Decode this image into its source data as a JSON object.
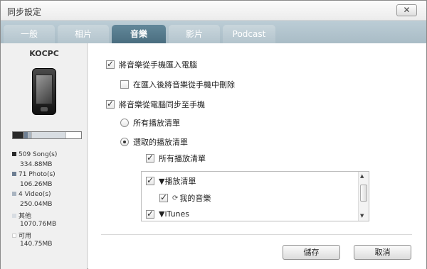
{
  "window": {
    "title": "同步設定",
    "close_label": "✕"
  },
  "tabs": [
    {
      "label": "一般",
      "active": false
    },
    {
      "label": "相片",
      "active": false
    },
    {
      "label": "音樂",
      "active": true
    },
    {
      "label": "影片",
      "active": false
    },
    {
      "label": "Podcast",
      "active": false
    }
  ],
  "device": {
    "name": "KOCPC",
    "storage_segments": [
      {
        "color": "#2a2a2a",
        "fraction": 0.16
      },
      {
        "color": "#6d7e92",
        "fraction": 0.06
      },
      {
        "color": "#a9b4c0",
        "fraction": 0.05
      },
      {
        "color": "#d8dde2",
        "fraction": 0.5
      },
      {
        "color": "#ffffff",
        "fraction": 0.23
      }
    ],
    "legend": [
      {
        "label": "509 Song(s)",
        "value": "334.88MB",
        "color": "#2a2a2a"
      },
      {
        "label": "71 Photo(s)",
        "value": "106.26MB",
        "color": "#6d7e92"
      },
      {
        "label": "4 Video(s)",
        "value": "250.04MB",
        "color": "#a9b4c0"
      },
      {
        "label": "其他",
        "value": "1070.76MB",
        "color": "#d8dde2"
      },
      {
        "label": "可用",
        "value": "140.75MB",
        "color": "#ffffff"
      }
    ]
  },
  "options": {
    "import_music": {
      "label": "將音樂從手機匯入電腦",
      "checked": true
    },
    "delete_after_import": {
      "label": "在匯入後將音樂從手機中刪除",
      "checked": false
    },
    "sync_music": {
      "label": "將音樂從電腦同步至手機",
      "checked": true
    },
    "all_playlists_radio": {
      "label": "所有播放清單",
      "checked": false
    },
    "selected_playlists_radio": {
      "label": "選取的播放清單",
      "checked": true
    },
    "all_playlists_checkbox": {
      "label": "所有播放清單",
      "checked": true
    }
  },
  "tree": {
    "items": [
      {
        "label": "▼播放清單",
        "checked": true
      },
      {
        "label": "我的音樂",
        "checked": true,
        "icon": "sync-icon"
      },
      {
        "label": "▼iTunes",
        "checked": true
      }
    ]
  },
  "buttons": {
    "save": "儲存",
    "cancel": "取消"
  }
}
